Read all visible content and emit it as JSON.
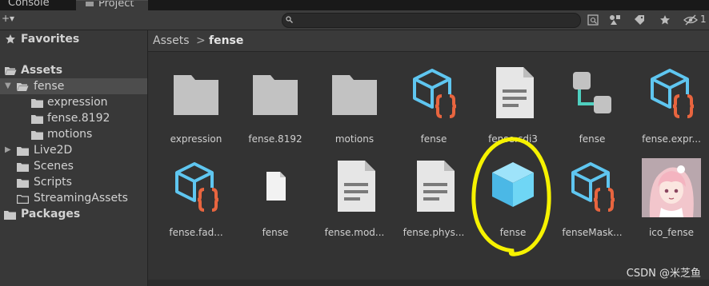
{
  "tabs": {
    "console": "Console",
    "project": "Project"
  },
  "toolbar": {
    "create_glyph": "+▾",
    "search_placeholder": "",
    "hidden_count": "1"
  },
  "tree": {
    "favorites": "Favorites",
    "assets": "Assets",
    "fense": "fense",
    "expression": "expression",
    "fense8192": "fense.8192",
    "motions": "motions",
    "live2d": "Live2D",
    "scenes": "Scenes",
    "scripts": "Scripts",
    "streaming": "StreamingAssets",
    "packages": "Packages"
  },
  "breadcrumb": {
    "root": "Assets",
    "separator": ">",
    "current": "fense"
  },
  "grid": {
    "row1": [
      "expression",
      "fense.8192",
      "motions",
      "fense",
      "fense.cdi3",
      "fense",
      "fense.expr..."
    ],
    "row2": [
      "fense.fad...",
      "fense",
      "fense.mod...",
      "fense.phys...",
      "fense",
      "fenseMask...",
      "ico_fense"
    ]
  },
  "colors": {
    "folder": "#c2c2c2",
    "cube": "#5fc6f0",
    "braces": "#e8653f",
    "highlight": "#f6f200",
    "prefab": "#6fd6f5"
  },
  "watermark": "CSDN @米芝鱼"
}
